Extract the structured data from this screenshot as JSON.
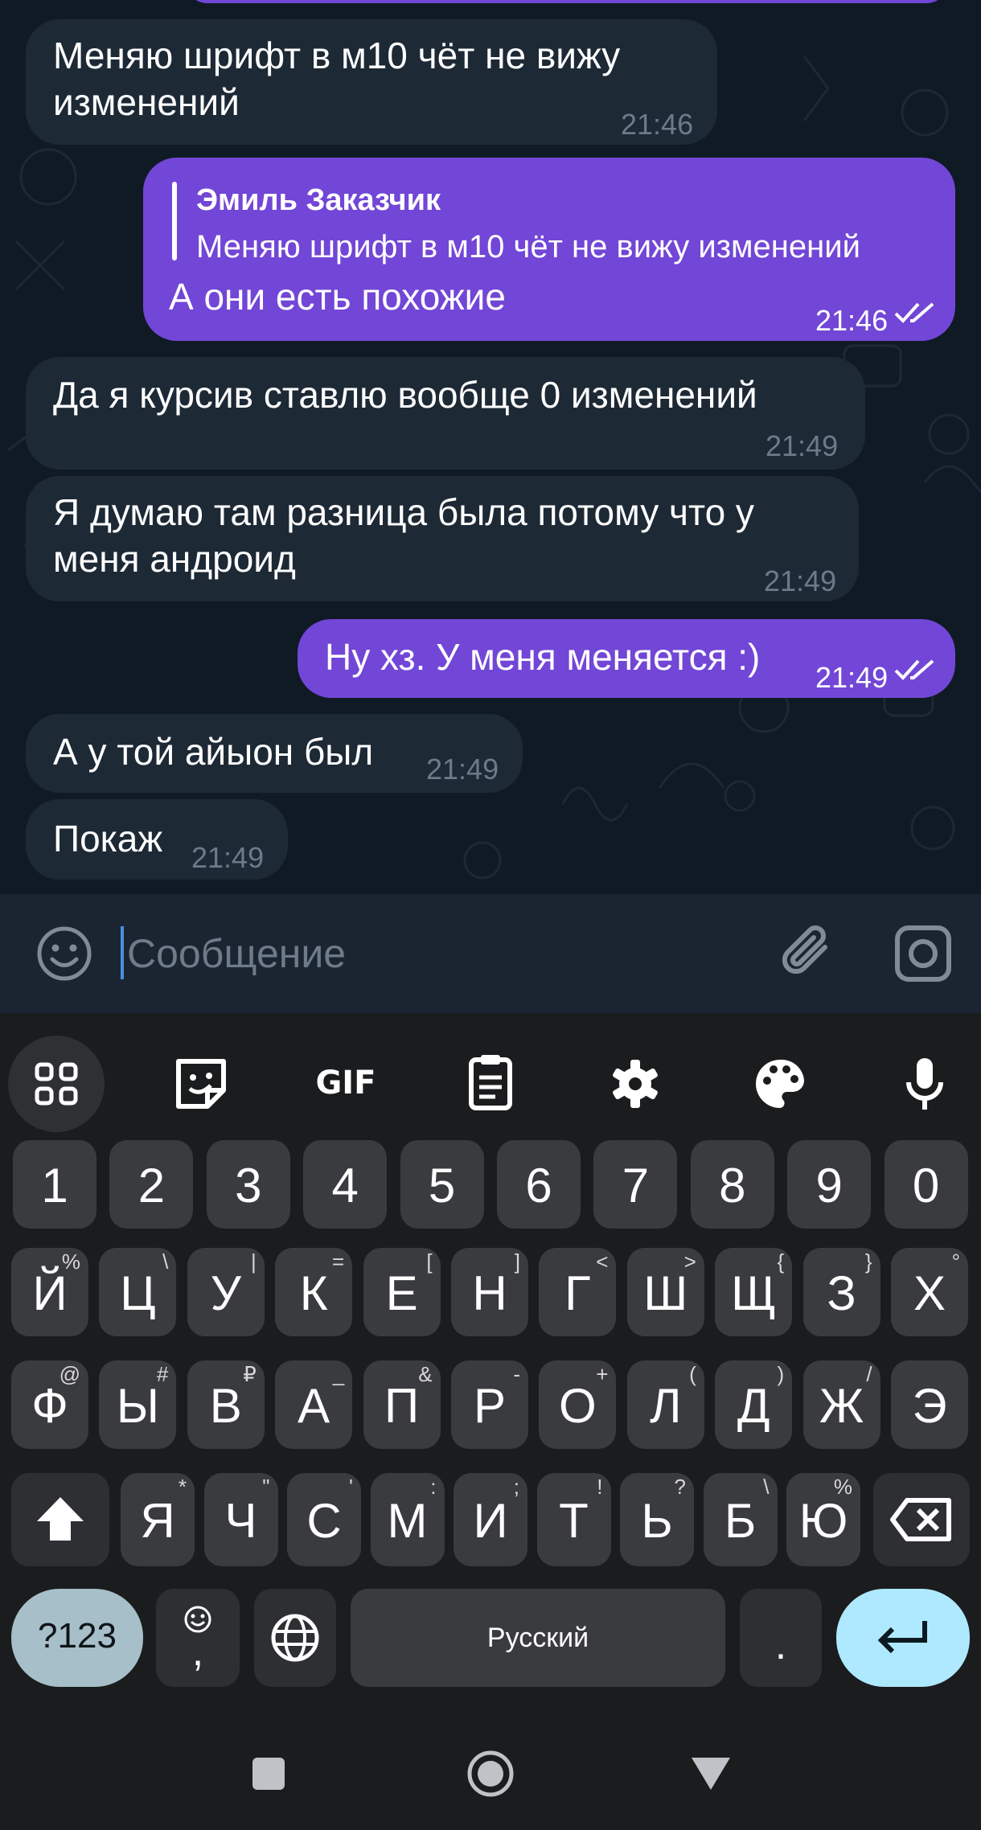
{
  "chat": {
    "messages": [
      {
        "dir": "in",
        "text_lines": [
          "Меняю шрифт в м10 чёт не вижу",
          "изменений"
        ],
        "time": "21:46"
      },
      {
        "dir": "out",
        "quote": {
          "author": "Эмиль Заказчик",
          "text": "Меняю шрифт в м10 чёт не вижу изменений"
        },
        "text": "А они есть похожие",
        "time": "21:46",
        "status": "read"
      },
      {
        "dir": "in",
        "text": "Да я курсив ставлю вообще 0 изменений",
        "time": "21:49"
      },
      {
        "dir": "in",
        "text_lines": [
          "Я думаю там разница была потому что у",
          "меня андроид"
        ],
        "time": "21:49"
      },
      {
        "dir": "out",
        "text": "Ну хз. У меня меняется :)",
        "time": "21:49",
        "status": "read"
      },
      {
        "dir": "in",
        "text": "А у той айыон был",
        "time": "21:49"
      },
      {
        "dir": "in",
        "text": "Покаж",
        "time": "21:49"
      }
    ],
    "colors": {
      "background": "#0f1a24",
      "incoming": "#1d2935",
      "outgoing": "#7246d6"
    }
  },
  "composer": {
    "placeholder": "Сообщение",
    "value": "",
    "icons": {
      "left": "emoji-icon",
      "attach": "paperclip-icon",
      "camera": "camera-icon"
    }
  },
  "keyboard": {
    "toolbar": [
      {
        "name": "apps-grid-icon"
      },
      {
        "name": "sticker-icon"
      },
      {
        "name": "gif-icon",
        "label": "GIF"
      },
      {
        "name": "clipboard-icon"
      },
      {
        "name": "settings-icon"
      },
      {
        "name": "theme-palette-icon"
      },
      {
        "name": "mic-icon"
      }
    ],
    "rows": [
      [
        {
          "k": "1"
        },
        {
          "k": "2"
        },
        {
          "k": "3"
        },
        {
          "k": "4"
        },
        {
          "k": "5"
        },
        {
          "k": "6"
        },
        {
          "k": "7"
        },
        {
          "k": "8"
        },
        {
          "k": "9"
        },
        {
          "k": "0"
        }
      ],
      [
        {
          "k": "Й",
          "s": "%"
        },
        {
          "k": "Ц",
          "s": "\\"
        },
        {
          "k": "У",
          "s": "|"
        },
        {
          "k": "К",
          "s": "="
        },
        {
          "k": "Е",
          "s": "["
        },
        {
          "k": "Н",
          "s": "]"
        },
        {
          "k": "Г",
          "s": "<"
        },
        {
          "k": "Ш",
          "s": ">"
        },
        {
          "k": "Щ",
          "s": "{"
        },
        {
          "k": "З",
          "s": "}"
        },
        {
          "k": "Х",
          "s": "°"
        }
      ],
      [
        {
          "k": "Ф",
          "s": "@"
        },
        {
          "k": "Ы",
          "s": "#"
        },
        {
          "k": "В",
          "s": "₽"
        },
        {
          "k": "А",
          "s": "_"
        },
        {
          "k": "П",
          "s": "&"
        },
        {
          "k": "Р",
          "s": "-"
        },
        {
          "k": "О",
          "s": "+"
        },
        {
          "k": "Л",
          "s": "("
        },
        {
          "k": "Д",
          "s": ")"
        },
        {
          "k": "Ж",
          "s": "/"
        },
        {
          "k": "Э",
          "s": ""
        }
      ],
      [
        {
          "k": "Я",
          "s": "*"
        },
        {
          "k": "Ч",
          "s": "\""
        },
        {
          "k": "С",
          "s": "'"
        },
        {
          "k": "М",
          "s": ":"
        },
        {
          "k": "И",
          "s": ";"
        },
        {
          "k": "Т",
          "s": "!"
        },
        {
          "k": "Ь",
          "s": "?"
        },
        {
          "k": "Б",
          "s": "\\"
        },
        {
          "k": "Ю",
          "s": "%"
        }
      ]
    ],
    "bottom": {
      "sym": "?123",
      "comma": ",",
      "space": "Русский",
      "period": "."
    },
    "colors": {
      "enter": "#aee9ff",
      "sym": "#a6bfc8",
      "key": "#3a3b3e"
    }
  },
  "navbar": {
    "icons": [
      "recents-icon",
      "home-icon",
      "back-icon"
    ]
  }
}
